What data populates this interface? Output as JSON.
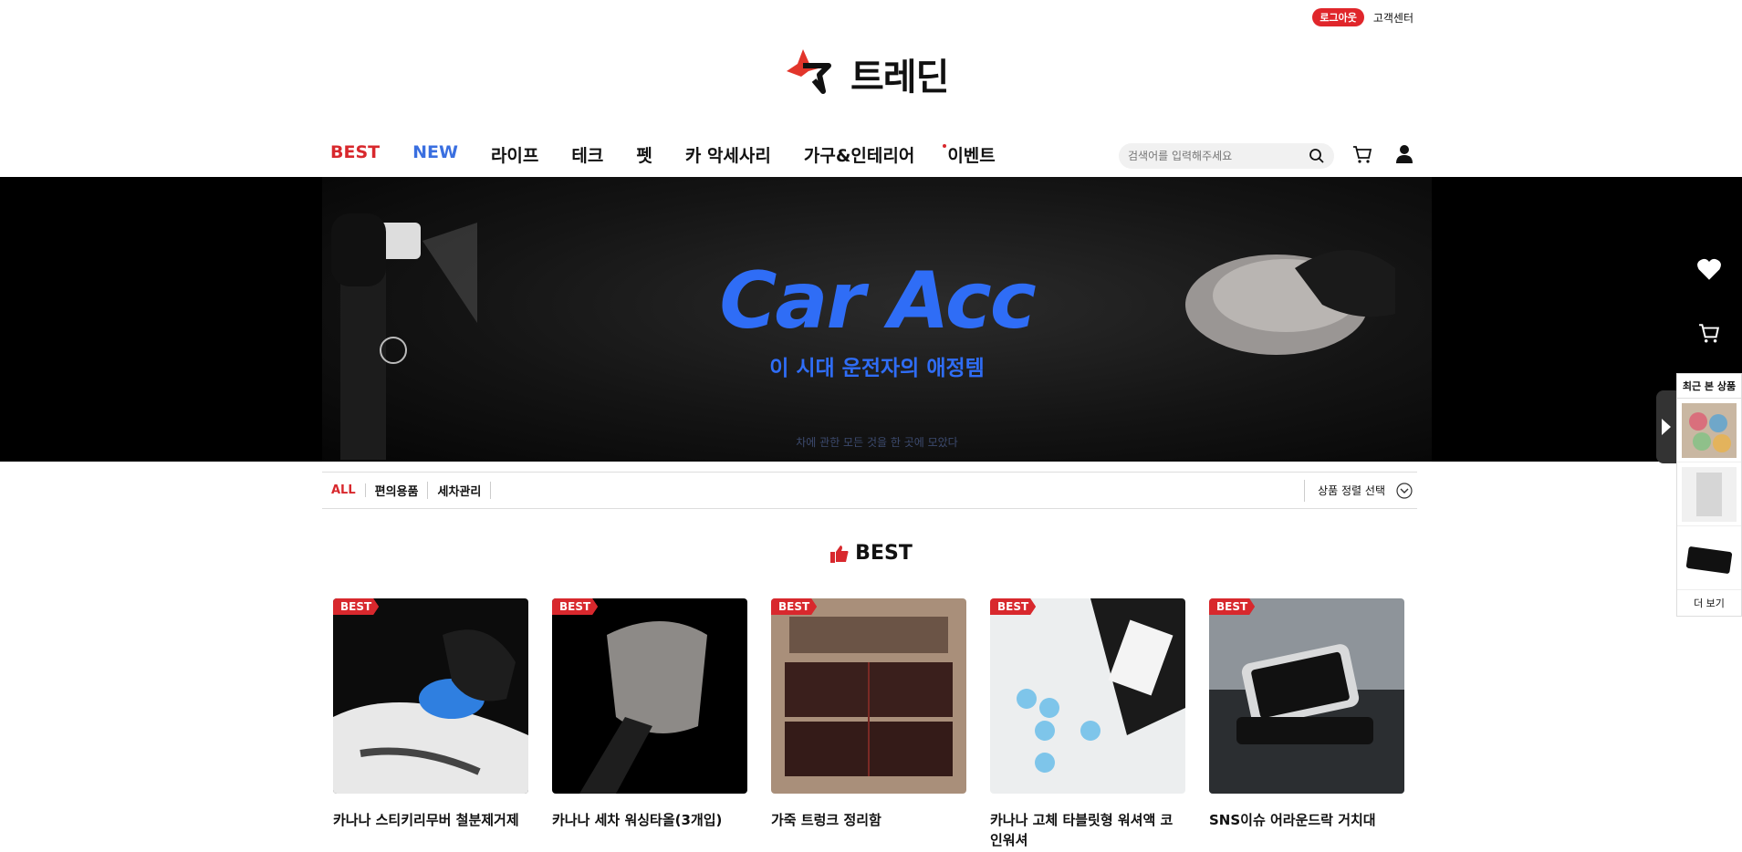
{
  "top": {
    "logout": "로그아웃",
    "support": "고객센터"
  },
  "logo": {
    "text": "트레딘"
  },
  "nav": {
    "items": [
      {
        "label": "BEST"
      },
      {
        "label": "NEW"
      },
      {
        "label": "라이프"
      },
      {
        "label": "테크"
      },
      {
        "label": "펫"
      },
      {
        "label": "카 악세사리"
      },
      {
        "label": "가구&인테리어"
      },
      {
        "label": "이벤트"
      }
    ]
  },
  "search": {
    "placeholder": "검색어를 입력해주세요"
  },
  "hero": {
    "title": "Car Acc",
    "subtitle": "이 시대 운전자의 애정템",
    "caption": "차에 관한 모든 것을 한 곳에 모았다"
  },
  "filter": {
    "categories": [
      "ALL",
      "편의용품",
      "세차관리"
    ],
    "sort": "상품 정렬 선택"
  },
  "section": {
    "title": "BEST"
  },
  "products": [
    {
      "badge": "BEST",
      "name": "카나나 스티키리무버 철분제거제"
    },
    {
      "badge": "BEST",
      "name": "카나나 세차 워싱타올(3개입)"
    },
    {
      "badge": "BEST",
      "name": "가죽 트렁크 정리함"
    },
    {
      "badge": "BEST",
      "name": "카나나 고체 타블릿형 워셔액 코인워셔"
    },
    {
      "badge": "BEST",
      "name": "SNS이슈 어라운드락 거치대"
    }
  ],
  "side": {
    "recent_title": "최근 본 상품",
    "more": "더 보기"
  },
  "colors": {
    "accent": "#d8282d",
    "new": "#3a6fe0",
    "hero_blue": "#2f6df6"
  }
}
